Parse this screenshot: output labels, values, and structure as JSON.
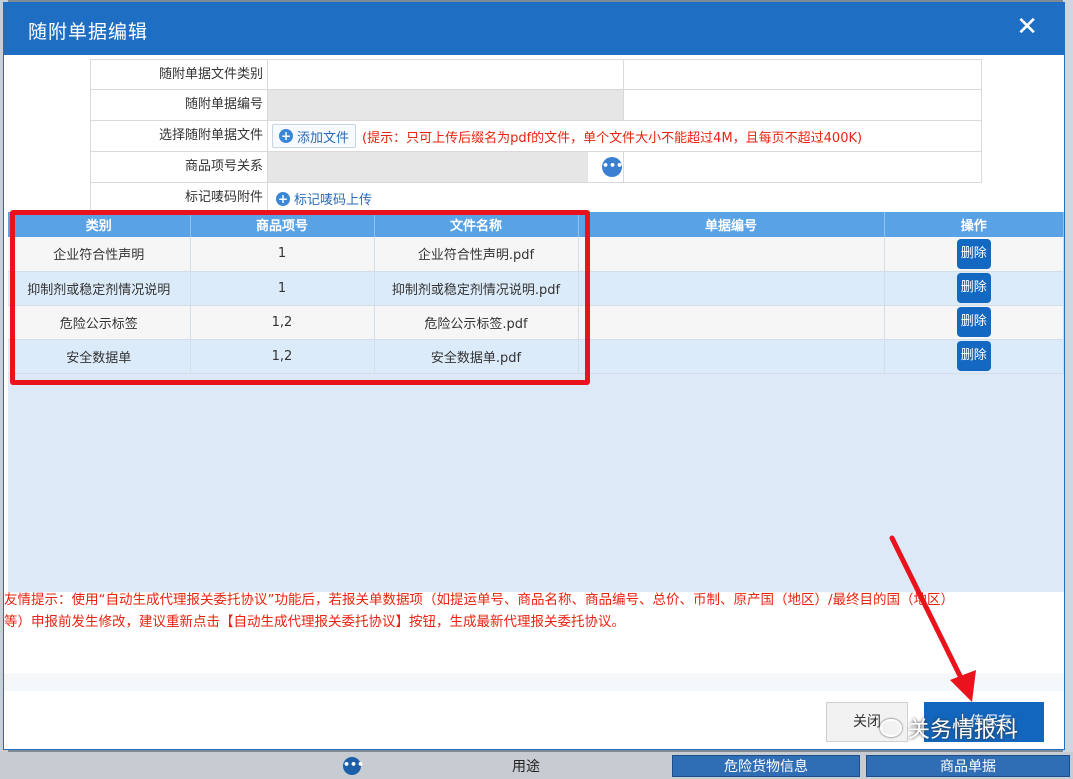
{
  "background": {
    "bottom_label": "用途",
    "tab_dangerous": "危险货物信息",
    "tab_goods_doc": "商品单据"
  },
  "modal": {
    "title": "随附单据编辑",
    "close_glyph": "✕"
  },
  "form": {
    "doc_type_label": "随附单据文件类别",
    "doc_no_label": "随附单据编号",
    "select_file_label": "选择随附单据文件",
    "add_file_button": "添加文件",
    "upload_hint": "(提示：只可上传后缀名为pdf的文件，单个文件大小不能超过4M，且每页不超过400K)",
    "goods_relation_label": "商品项号关系",
    "mark_attachment_label": "标记唛码附件",
    "mark_upload_link": "标记唛码上传"
  },
  "table": {
    "headers": [
      "类别",
      "商品项号",
      "文件名称",
      "单据编号",
      "操作"
    ],
    "rows": [
      {
        "category": "企业符合性声明",
        "item_no": "1",
        "file_name": "企业符合性声明.pdf",
        "doc_no": "",
        "action": "删除"
      },
      {
        "category": "抑制剂或稳定剂情况说明",
        "item_no": "1",
        "file_name": "抑制剂或稳定剂情况说明.pdf",
        "doc_no": "",
        "action": "删除"
      },
      {
        "category": "危险公示标签",
        "item_no": "1,2",
        "file_name": "危险公示标签.pdf",
        "doc_no": "",
        "action": "删除"
      },
      {
        "category": "安全数据单",
        "item_no": "1,2",
        "file_name": "安全数据单.pdf",
        "doc_no": "",
        "action": "删除"
      }
    ]
  },
  "notice": {
    "line1": "友情提示：使用“自动生成代理报关委托协议”功能后，若报关单数据项（如提运单号、商品名称、商品编号、总价、币制、原产国（地区）/最终目的国（地区）",
    "line2": "等）申报前发生修改，建议重新点击【自动生成代理报关委托协议】按钮，生成最新代理报关委托协议。"
  },
  "footer": {
    "close_button": "关闭",
    "upload_button": "上传保存"
  },
  "watermark": {
    "text": "关务情报科"
  },
  "colors": {
    "header_blue": "#1e6fc3",
    "table_header": "#5aa2e6",
    "delete_button": "#1468c2",
    "hint_red": "#e8230f",
    "highlight_red": "#e8131c"
  }
}
